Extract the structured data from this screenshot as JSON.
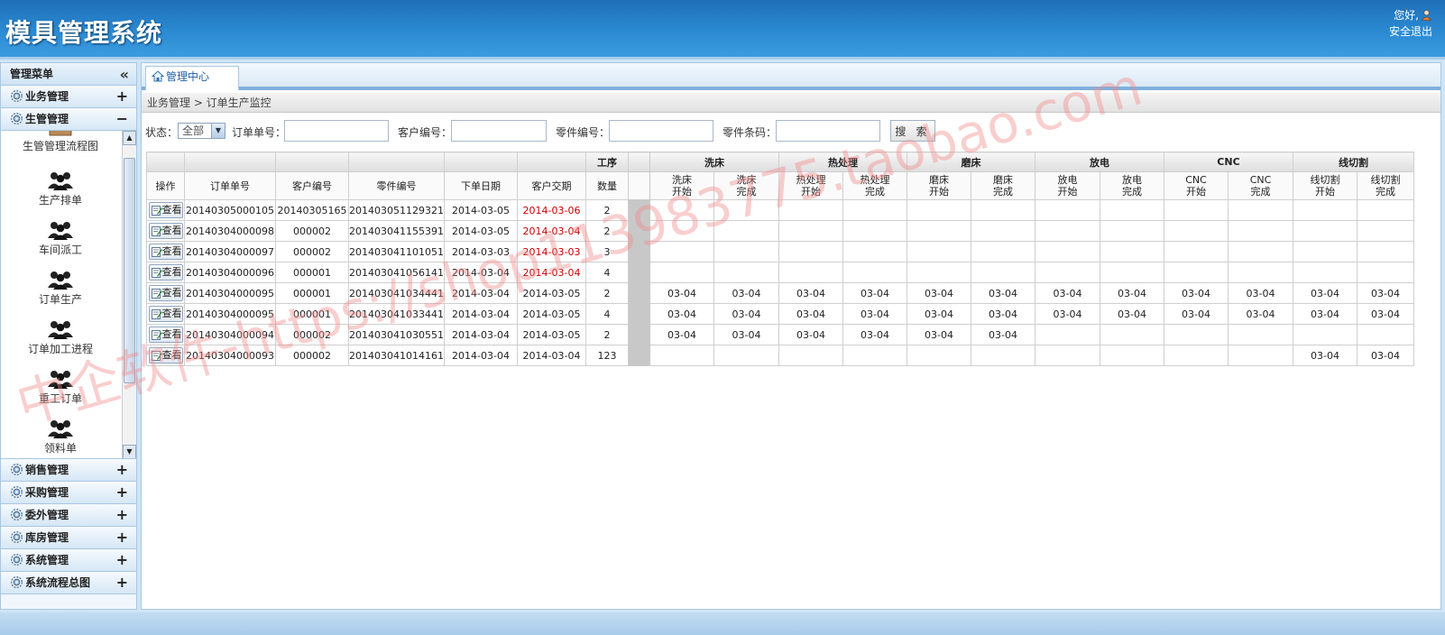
{
  "app": {
    "title": "模具管理系统",
    "greeting": "您好,",
    "logout": "安全退出"
  },
  "sidebar": {
    "header": "管理菜单",
    "groups_top": [
      {
        "label": "业务管理",
        "toggle": "+"
      },
      {
        "label": "生管管理",
        "toggle": "−"
      }
    ],
    "sub_items": [
      {
        "label": "生管管理流程图",
        "icon": "box-icon"
      },
      {
        "label": "生产排单",
        "icon": "users-icon"
      },
      {
        "label": "车间派工",
        "icon": "users-icon"
      },
      {
        "label": "订单生产",
        "icon": "users-icon"
      },
      {
        "label": "订单加工进程",
        "icon": "users-icon"
      },
      {
        "label": "重工订单",
        "icon": "users-icon"
      },
      {
        "label": "领料单",
        "icon": "users-icon"
      }
    ],
    "groups_bottom": [
      {
        "label": "销售管理",
        "toggle": "+"
      },
      {
        "label": "采购管理",
        "toggle": "+"
      },
      {
        "label": "委外管理",
        "toggle": "+"
      },
      {
        "label": "库房管理",
        "toggle": "+"
      },
      {
        "label": "系统管理",
        "toggle": "+"
      },
      {
        "label": "系统流程总图",
        "toggle": "+"
      }
    ]
  },
  "main": {
    "tab_label": "管理中心",
    "breadcrumb": "业务管理 > 订单生产监控",
    "filters": {
      "status_label": "状态：",
      "status_value": "全部",
      "order_label": "订单单号：",
      "customer_label": "客户编号：",
      "part_label": "零件编号：",
      "barcode_label": "零件条码：",
      "search_label": "搜 索"
    }
  },
  "table": {
    "process_header": "工序",
    "group_headers": [
      "洗床",
      "热处理",
      "磨床",
      "放电",
      "CNC",
      "线切割"
    ],
    "columns": [
      "操作",
      "订单单号",
      "客户编号",
      "零件编号",
      "下单日期",
      "客户交期",
      "数量"
    ],
    "sub_columns": [
      [
        "洗床",
        "开始"
      ],
      [
        "洗床",
        "完成"
      ],
      [
        "热处理",
        "开始"
      ],
      [
        "热处理",
        "完成"
      ],
      [
        "磨床",
        "开始"
      ],
      [
        "磨床",
        "完成"
      ],
      [
        "放电",
        "开始"
      ],
      [
        "放电",
        "完成"
      ],
      [
        "CNC",
        "开始"
      ],
      [
        "CNC",
        "完成"
      ],
      [
        "线切割",
        "开始"
      ],
      [
        "线切割",
        "完成"
      ]
    ],
    "view_label": "查看",
    "rows": [
      {
        "order": "20140305000105",
        "customer": "20140305165",
        "part": "201403051129321",
        "order_date": "2014-03-05",
        "due": "2014-03-06",
        "due_late": true,
        "qty": "2",
        "steps": [
          "",
          "",
          "",
          "",
          "",
          "",
          "",
          "",
          "",
          "",
          "",
          ""
        ]
      },
      {
        "order": "20140304000098",
        "customer": "000002",
        "part": "201403041155391",
        "order_date": "2014-03-05",
        "due": "2014-03-04",
        "due_late": true,
        "qty": "2",
        "steps": [
          "",
          "",
          "",
          "",
          "",
          "",
          "",
          "",
          "",
          "",
          "",
          ""
        ]
      },
      {
        "order": "20140304000097",
        "customer": "000002",
        "part": "201403041101051",
        "order_date": "2014-03-03",
        "due": "2014-03-03",
        "due_late": true,
        "qty": "3",
        "steps": [
          "",
          "",
          "",
          "",
          "",
          "",
          "",
          "",
          "",
          "",
          "",
          ""
        ]
      },
      {
        "order": "20140304000096",
        "customer": "000001",
        "part": "201403041056141",
        "order_date": "2014-03-04",
        "due": "2014-03-04",
        "due_late": true,
        "qty": "4",
        "steps": [
          "",
          "",
          "",
          "",
          "",
          "",
          "",
          "",
          "",
          "",
          "",
          ""
        ]
      },
      {
        "order": "20140304000095",
        "customer": "000001",
        "part": "201403041034441",
        "order_date": "2014-03-04",
        "due": "2014-03-05",
        "due_late": false,
        "qty": "2",
        "steps": [
          "03-04",
          "03-04",
          "03-04",
          "03-04",
          "03-04",
          "03-04",
          "03-04",
          "03-04",
          "03-04",
          "03-04",
          "03-04",
          "03-04"
        ]
      },
      {
        "order": "20140304000095",
        "customer": "000001",
        "part": "201403041033441",
        "order_date": "2014-03-04",
        "due": "2014-03-05",
        "due_late": false,
        "qty": "4",
        "steps": [
          "03-04",
          "03-04",
          "03-04",
          "03-04",
          "03-04",
          "03-04",
          "03-04",
          "03-04",
          "03-04",
          "03-04",
          "03-04",
          "03-04"
        ]
      },
      {
        "order": "20140304000094",
        "customer": "000002",
        "part": "201403041030551",
        "order_date": "2014-03-04",
        "due": "2014-03-05",
        "due_late": false,
        "qty": "2",
        "steps": [
          "03-04",
          "03-04",
          "03-04",
          "03-04",
          "03-04",
          "03-04",
          "",
          "",
          "",
          "",
          "",
          ""
        ]
      },
      {
        "order": "20140304000093",
        "customer": "000002",
        "part": "201403041014161",
        "order_date": "2014-03-04",
        "due": "2014-03-04",
        "due_late": false,
        "qty": "123",
        "steps": [
          "",
          "",
          "",
          "",
          "",
          "",
          "",
          "",
          "",
          "",
          "03-04",
          "03-04"
        ]
      }
    ]
  },
  "watermark": "中企软件-https://shop113983775.taobao.com",
  "colors": {
    "header_blue": "#2b8ad2",
    "late_red": "#cc0000",
    "watermark": "#f08a8a"
  }
}
